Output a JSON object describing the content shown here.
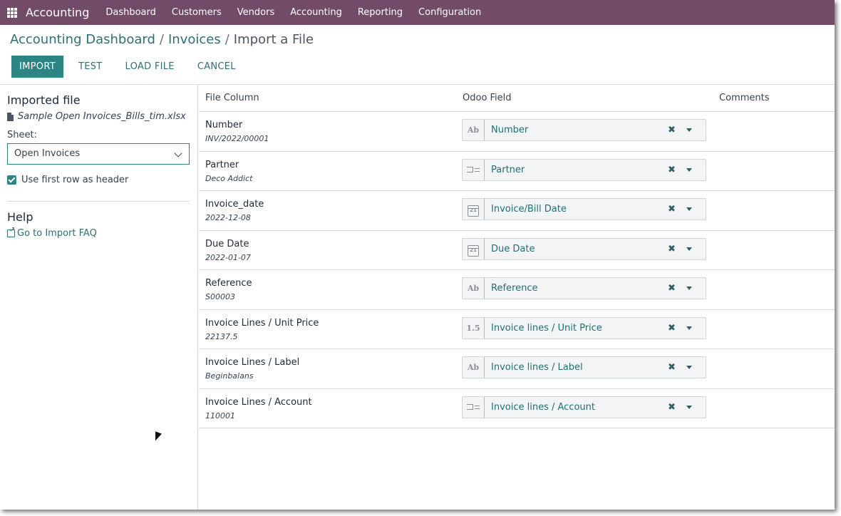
{
  "navbar": {
    "brand": "Accounting",
    "items": [
      "Dashboard",
      "Customers",
      "Vendors",
      "Accounting",
      "Reporting",
      "Configuration"
    ]
  },
  "breadcrumb": {
    "items": [
      "Accounting Dashboard",
      "Invoices"
    ],
    "separator": "/",
    "current": "Import a File"
  },
  "actions": {
    "import_label": "IMPORT",
    "test_label": "TEST",
    "load_file_label": "LOAD FILE",
    "cancel_label": "CANCEL"
  },
  "sidebar": {
    "imported_title": "Imported file",
    "file_name": "Sample Open Invoices_Bills_tim.xlsx",
    "sheet_label": "Sheet:",
    "sheet_value": "Open Invoices",
    "header_checkbox_label": "Use first row as header",
    "header_checkbox_checked": true,
    "help_title": "Help",
    "faq_link": "Go to Import FAQ"
  },
  "table": {
    "headers": [
      "File Column",
      "Odoo Field",
      "Comments"
    ],
    "rows": [
      {
        "column": "Number",
        "sample": "INV/2022/00001",
        "field": "Number",
        "type_icon": "text-type-icon",
        "type_text": "Ab"
      },
      {
        "column": "Partner",
        "sample": "Deco Addict",
        "field": "Partner",
        "type_icon": "relation-type-icon",
        "type_text": ""
      },
      {
        "column": "Invoice_date",
        "sample": "2022-12-08",
        "field": "Invoice/Bill Date",
        "type_icon": "calendar-icon",
        "type_text": "21"
      },
      {
        "column": "Due Date",
        "sample": "2022-01-07",
        "field": "Due Date",
        "type_icon": "calendar-icon",
        "type_text": "21"
      },
      {
        "column": "Reference",
        "sample": "S00003",
        "field": "Reference",
        "type_icon": "text-type-icon",
        "type_text": "Ab"
      },
      {
        "column": "Invoice Lines / Unit Price",
        "sample": "22137.5",
        "field": "Invoice lines / Unit Price",
        "type_icon": "float-type-icon",
        "type_text": "1.5"
      },
      {
        "column": "Invoice Lines / Label",
        "sample": "Beginbalans",
        "field": "Invoice lines / Label",
        "type_icon": "text-type-icon",
        "type_text": "Ab"
      },
      {
        "column": "Invoice Lines / Account",
        "sample": "110001",
        "field": "Invoice lines / Account",
        "type_icon": "relation-type-icon",
        "type_text": ""
      }
    ],
    "clear_glyph": "✖"
  },
  "colors": {
    "navbar": "#714b67",
    "primary_button": "#2d8485",
    "link": "#2f6f73"
  }
}
